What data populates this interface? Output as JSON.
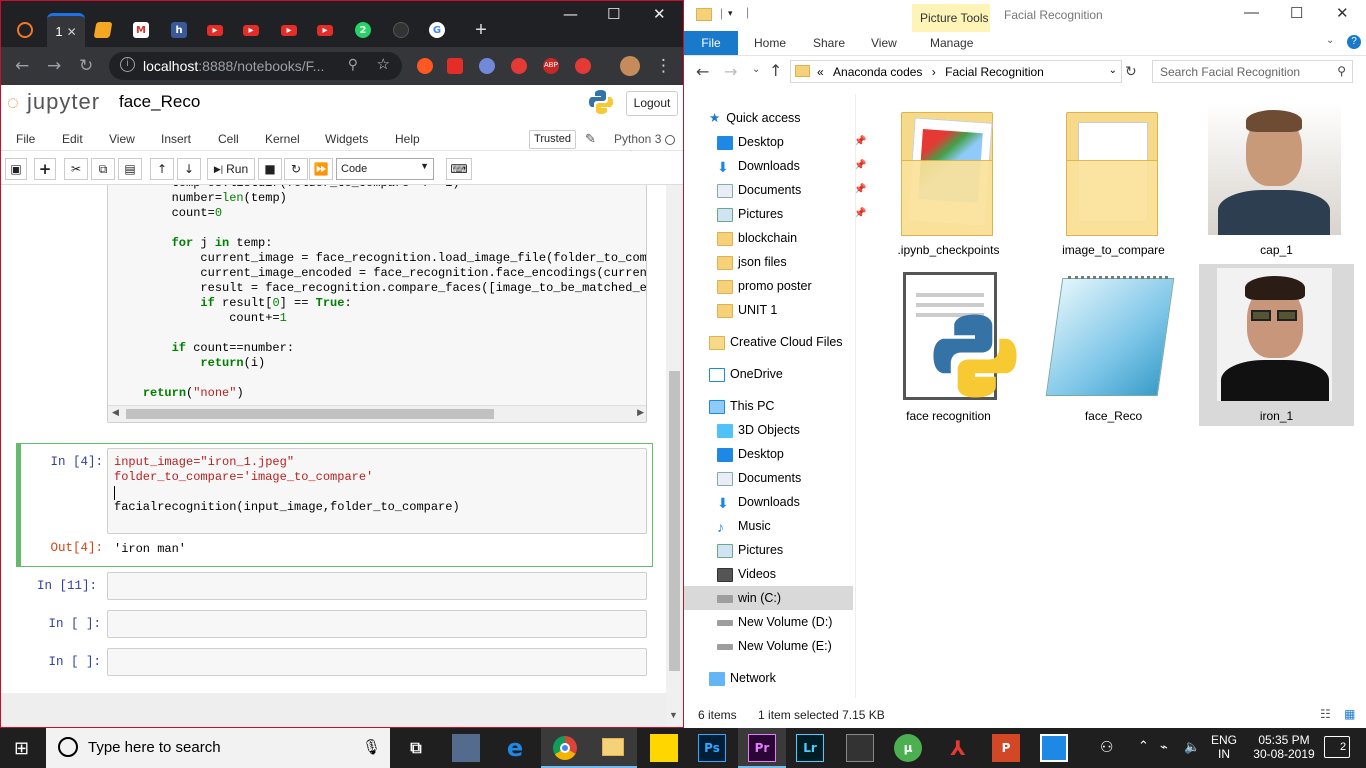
{
  "chrome": {
    "tab_active_label": "1",
    "url_host": "localhost",
    "url_port_path": ":8888/notebooks/F...",
    "window_min": "—",
    "window_max": "☐",
    "window_close": "✕"
  },
  "jupyter": {
    "logo_text": "jupyter",
    "notebook_name": "face_Reco",
    "logout_label": "Logout",
    "menu": [
      "File",
      "Edit",
      "View",
      "Insert",
      "Cell",
      "Kernel",
      "Widgets",
      "Help"
    ],
    "trusted_label": "Trusted",
    "kernel_label": "Python 3",
    "run_label": "Run",
    "cell_type": "Code",
    "cells": [
      {
        "prompt": "In [4]:",
        "code_lines": [
          "input_image=\"iron_1.jpeg\"",
          "folder_to_compare='image_to_compare'",
          "",
          "facialrecognition(input_image,folder_to_compare)"
        ],
        "out_prompt": "Out[4]:",
        "output": "'iron man'"
      },
      {
        "prompt": "In [11]:"
      },
      {
        "prompt": "In [ ]:"
      },
      {
        "prompt": "In [ ]:"
      }
    ]
  },
  "explorer": {
    "picture_tools": "Picture Tools",
    "title": "Facial Recognition",
    "ribbon_tabs": [
      "File",
      "Home",
      "Share",
      "View",
      "Manage"
    ],
    "address_root": "«",
    "address_parts": [
      "Anaconda codes",
      "Facial Recognition"
    ],
    "search_placeholder": "Search Facial Recognition",
    "nav": {
      "quick_access": "Quick access",
      "quick_items": [
        "Desktop",
        "Downloads",
        "Documents",
        "Pictures",
        "blockchain",
        "json files",
        "promo poster",
        "UNIT 1"
      ],
      "creative_cloud": "Creative Cloud Files",
      "onedrive": "OneDrive",
      "this_pc": "This PC",
      "pc_items": [
        "3D Objects",
        "Desktop",
        "Documents",
        "Downloads",
        "Music",
        "Pictures",
        "Videos",
        "win  (C:)",
        "New Volume (D:)",
        "New Volume (E:)"
      ],
      "network": "Network"
    },
    "files": [
      ".ipynb_checkpoints",
      "image_to_compare",
      "cap_1",
      "face recognition",
      "face_Reco",
      "iron_1"
    ],
    "status_count": "6 items",
    "status_selected": "1 item selected  7.15 KB"
  },
  "taskbar": {
    "search_placeholder": "Type here to search",
    "lang_top": "ENG",
    "lang_bottom": "IN",
    "time": "05:35 PM",
    "date": "30-08-2019",
    "notif_count": "2",
    "apps": [
      "Ps",
      "Pr",
      "Lr"
    ]
  }
}
